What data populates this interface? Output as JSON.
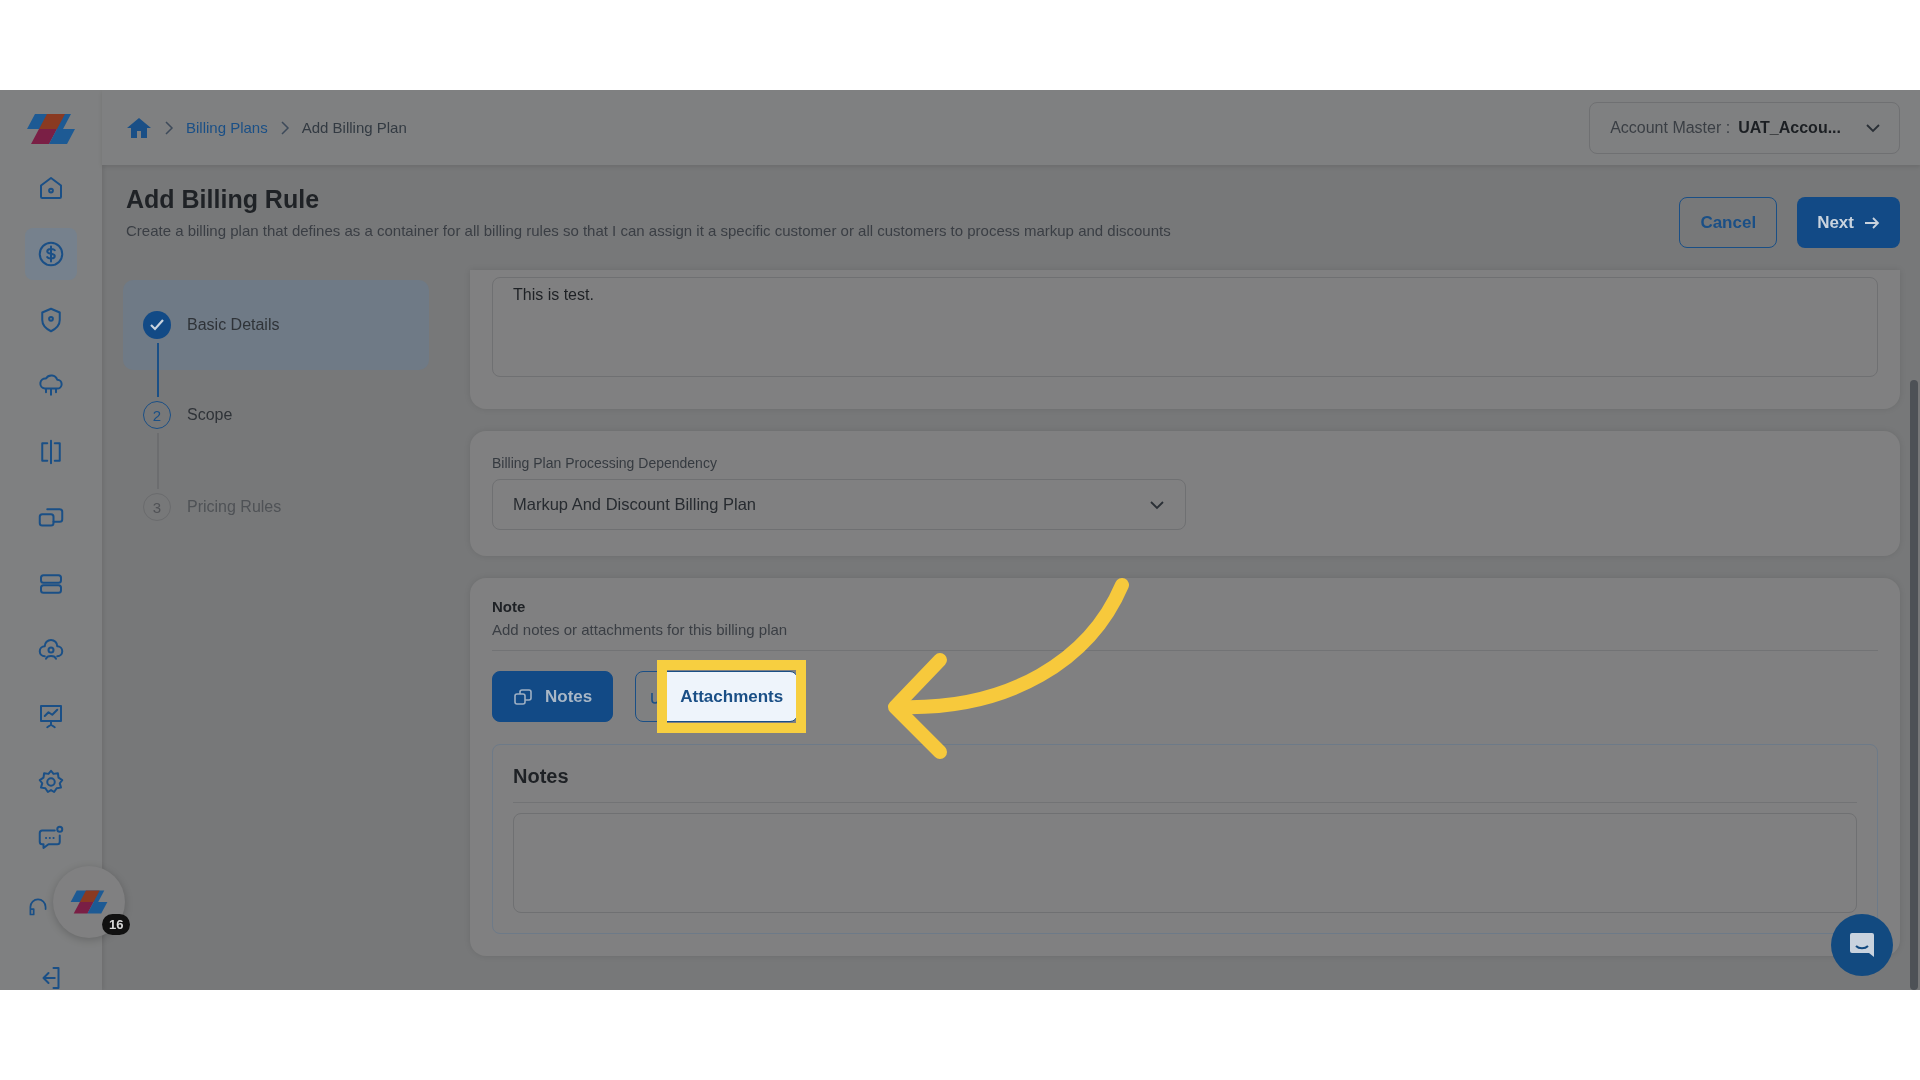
{
  "sidebar": {
    "items": [
      {
        "selected": false
      },
      {
        "selected": true
      },
      {
        "selected": false
      },
      {
        "selected": false
      },
      {
        "selected": false
      },
      {
        "selected": false
      },
      {
        "selected": false
      },
      {
        "selected": false
      },
      {
        "selected": false
      },
      {
        "selected": false
      }
    ],
    "bottom_items": [
      {
        "selected": false
      },
      {
        "selected": false
      },
      {
        "selected": false
      }
    ]
  },
  "breadcrumb": [
    "Billing Plans",
    "Add Billing Plan"
  ],
  "account": {
    "label": "Account Master :",
    "value": "UAT_Accou..."
  },
  "header": {
    "title": "Add Billing Rule",
    "subtitle": "Create a billing plan that defines as a container for all billing rules so that I can assign it a specific customer or all customers to process markup and discounts"
  },
  "actions": [
    {
      "label": "Cancel",
      "kind": "outline"
    },
    {
      "label": "Next",
      "kind": "primary"
    }
  ],
  "steps": [
    {
      "label": "Basic Details",
      "kind": "done",
      "selected": true
    },
    {
      "label": "Scope",
      "number": "2",
      "kind": "current",
      "selected": false
    },
    {
      "label": "Pricing Rules",
      "number": "3",
      "kind": "pending",
      "selected": false
    }
  ],
  "description": {
    "value": "This is test."
  },
  "dependency": {
    "label": "Billing Plan Processing Dependency",
    "value": "Markup And Discount Billing Plan"
  },
  "note": {
    "title": "Note",
    "subtitle": "Add notes or attachments for this billing plan",
    "tabs": [
      {
        "label": "Notes",
        "selected": true,
        "highlighted": false
      },
      {
        "label": "Attachments",
        "selected": false,
        "highlighted": true
      }
    ],
    "panel_title": "Notes"
  },
  "widget_badge": "16"
}
